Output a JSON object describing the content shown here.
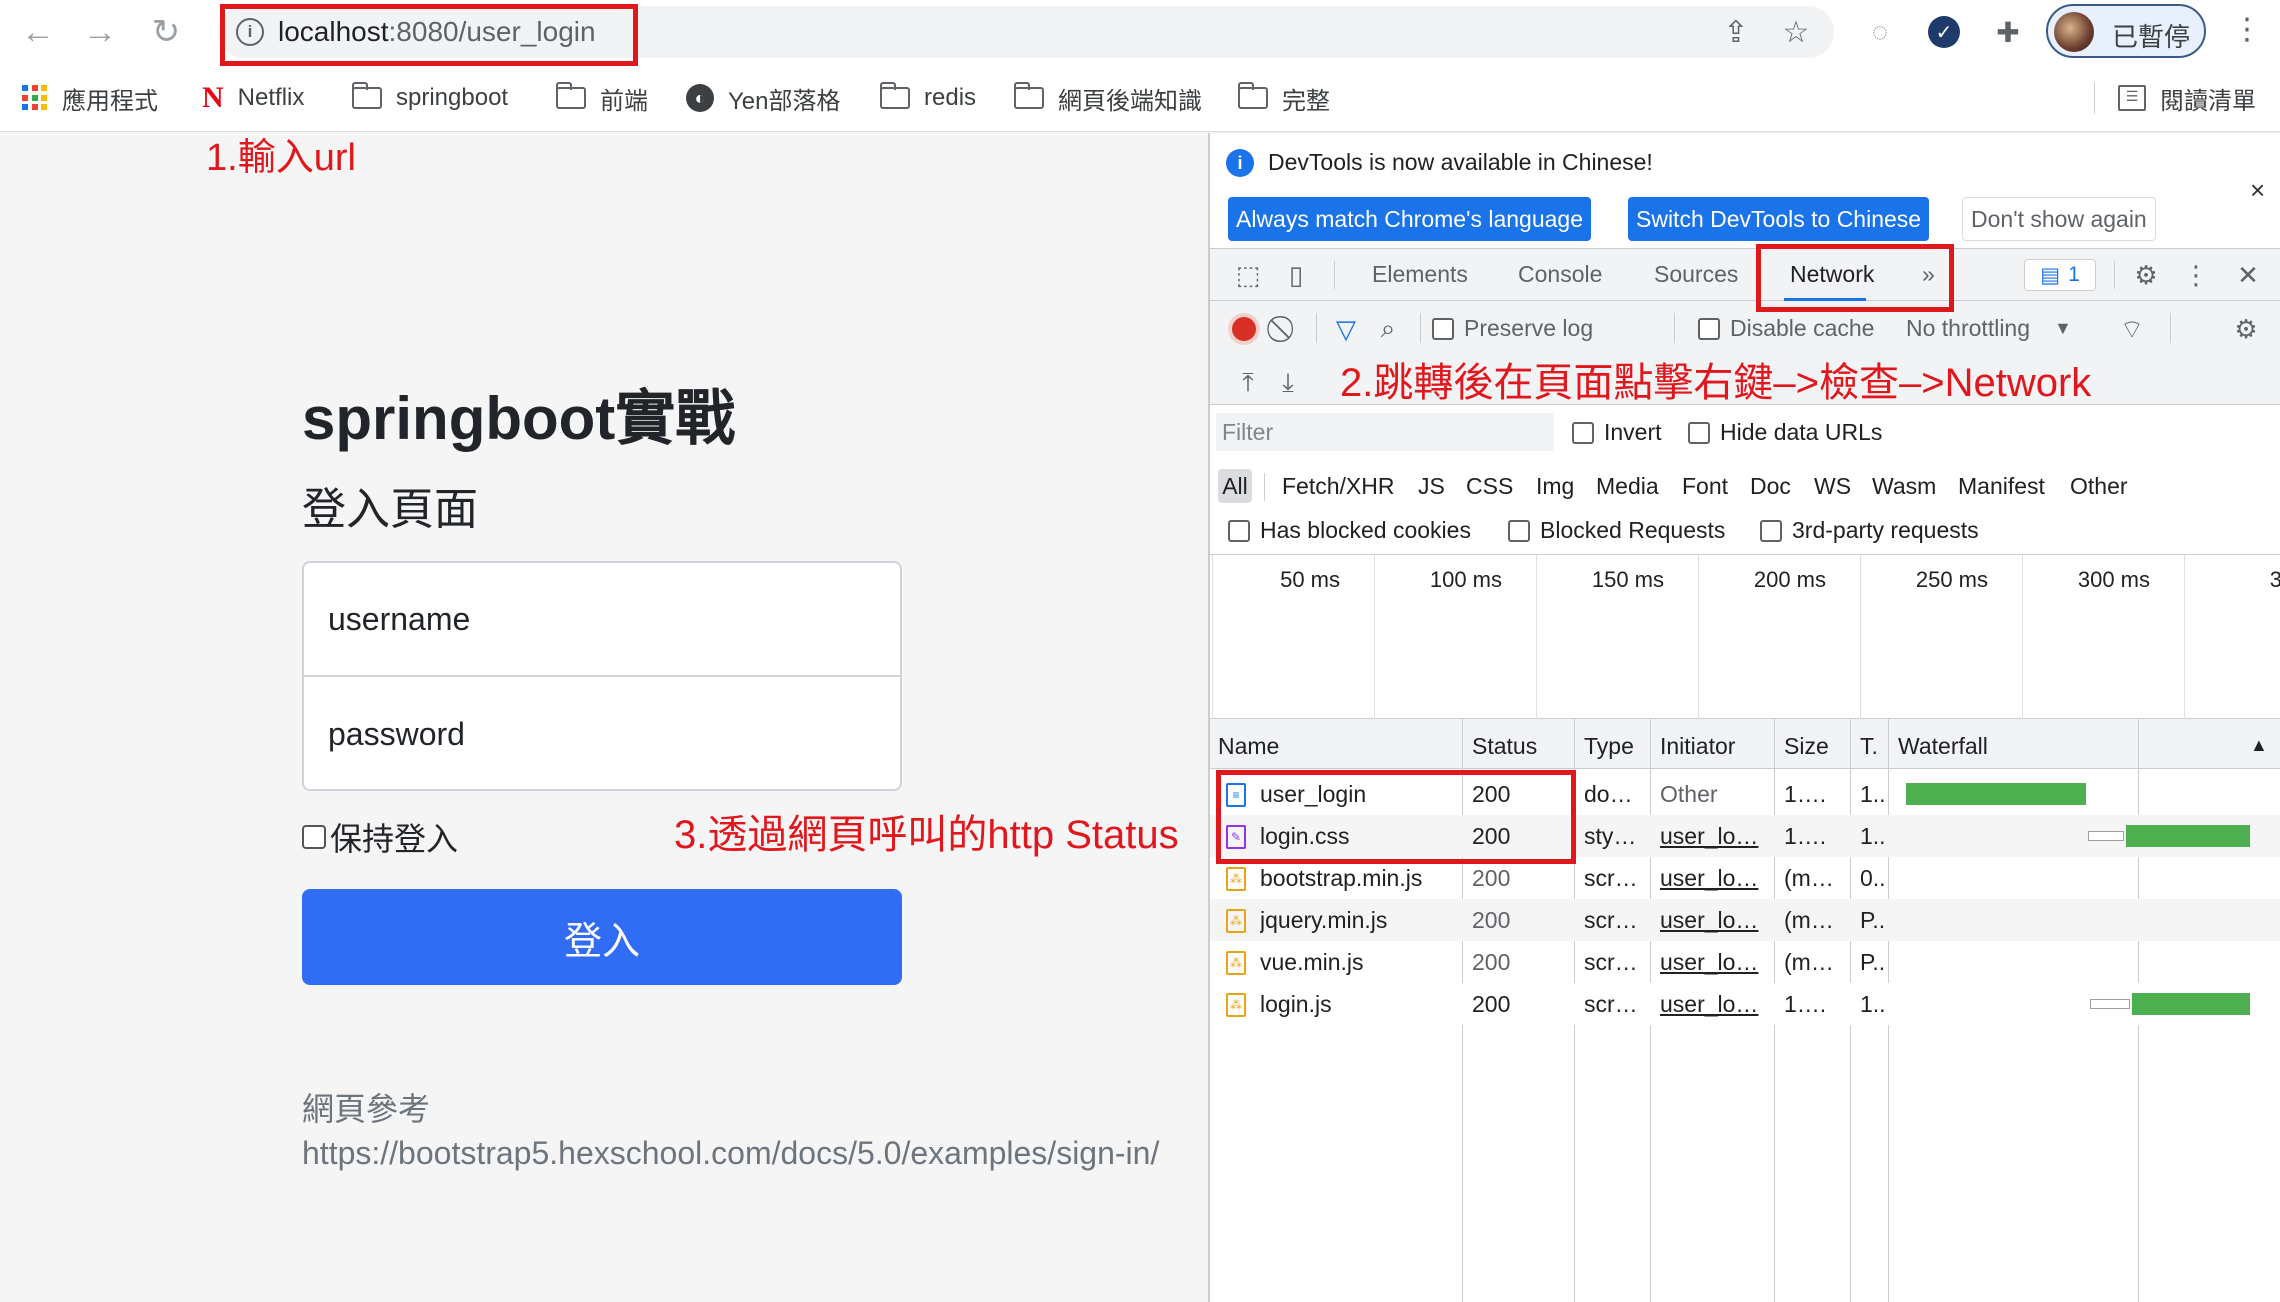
{
  "browser": {
    "url_host": "localhost",
    "url_rest": ":8080/user_login",
    "profile_label": "已暫停",
    "icons": [
      "back-icon",
      "forward-icon",
      "reload-icon",
      "info-icon",
      "share-icon",
      "star-icon",
      "extension-icon",
      "puzzle-icon",
      "menu-icon"
    ]
  },
  "bookmarks": [
    {
      "label": "應用程式",
      "icon": "apps-grid-icon"
    },
    {
      "label": "Netflix",
      "icon": "netflix-icon"
    },
    {
      "label": "springboot",
      "icon": "folder-icon"
    },
    {
      "label": "前端",
      "icon": "folder-icon"
    },
    {
      "label": "Yen部落格",
      "icon": "globe-icon"
    },
    {
      "label": "redis",
      "icon": "folder-icon"
    },
    {
      "label": "網頁後端知識",
      "icon": "folder-icon"
    },
    {
      "label": "完整",
      "icon": "folder-icon"
    }
  ],
  "reading_list": "閱讀清單",
  "page": {
    "title": "springboot實戰",
    "subtitle": "登入頁面",
    "username_placeholder": "username",
    "password_placeholder": "password",
    "remember_label": "保持登入",
    "login_button": "登入",
    "reference_label": "網頁參考",
    "reference_link": "https://bootstrap5.hexschool.com/docs/5.0/examples/sign-in/"
  },
  "annotations": {
    "step1": "1.輸入url",
    "step2": "2.跳轉後在頁面點擊右鍵–>檢查–>Network",
    "step3": "3.透過網頁呼叫的http Status",
    "color": "#e0171c"
  },
  "devtools": {
    "info_text": "DevTools is now available in Chinese!",
    "btn_match": "Always match Chrome's language",
    "btn_switch": "Switch DevTools to Chinese",
    "btn_dismiss": "Don't show again",
    "tabs": [
      "Elements",
      "Console",
      "Sources",
      "Network"
    ],
    "more_tabs": "»",
    "issues_count": "1",
    "preserve_log": "Preserve log",
    "disable_cache": "Disable cache",
    "throttling": "No throttling",
    "filter_placeholder": "Filter",
    "invert": "Invert",
    "hide_data_urls": "Hide data URLs",
    "type_filters": [
      "All",
      "Fetch/XHR",
      "JS",
      "CSS",
      "Img",
      "Media",
      "Font",
      "Doc",
      "WS",
      "Wasm",
      "Manifest",
      "Other"
    ],
    "has_blocked_cookies": "Has blocked cookies",
    "blocked_requests": "Blocked Requests",
    "third_party": "3rd-party requests",
    "timeline_labels": [
      "50 ms",
      "100 ms",
      "150 ms",
      "200 ms",
      "250 ms",
      "300 ms",
      "3"
    ],
    "columns": [
      "Name",
      "Status",
      "Type",
      "Initiator",
      "Size",
      "T.",
      "Waterfall"
    ],
    "rows": [
      {
        "name": "user_login",
        "status": "200",
        "type": "do…",
        "initiator": "Other",
        "size": "1….",
        "time": "1..",
        "kind": "doc"
      },
      {
        "name": "login.css",
        "status": "200",
        "type": "sty…",
        "initiator": "user_lo…",
        "size": "1….",
        "time": "1..",
        "kind": "css"
      },
      {
        "name": "bootstrap.min.js",
        "status": "200",
        "type": "scr…",
        "initiator": "user_lo…",
        "size": "(m…",
        "time": "0..",
        "kind": "js"
      },
      {
        "name": "jquery.min.js",
        "status": "200",
        "type": "scr…",
        "initiator": "user_lo…",
        "size": "(m…",
        "time": "P..",
        "kind": "js"
      },
      {
        "name": "vue.min.js",
        "status": "200",
        "type": "scr…",
        "initiator": "user_lo…",
        "size": "(m…",
        "time": "P..",
        "kind": "js"
      },
      {
        "name": "login.js",
        "status": "200",
        "type": "scr…",
        "initiator": "user_lo…",
        "size": "1….",
        "time": "1..",
        "kind": "js"
      }
    ]
  }
}
